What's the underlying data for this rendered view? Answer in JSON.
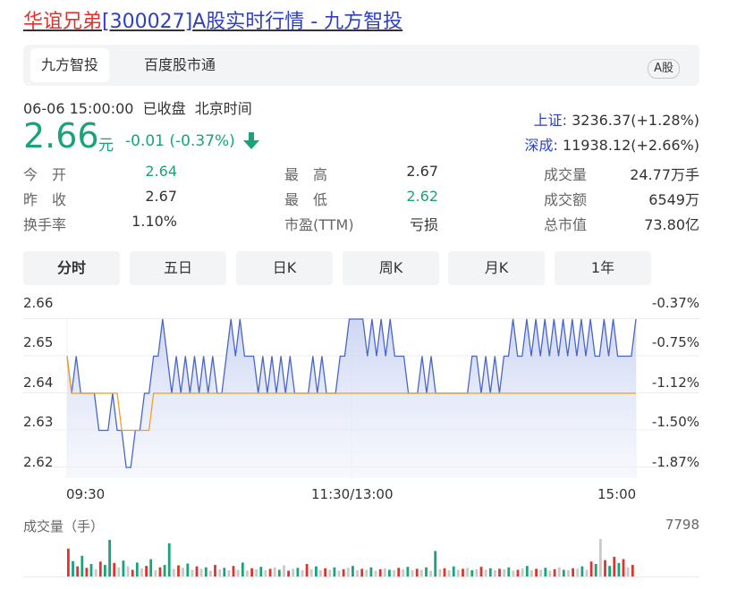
{
  "header": {
    "name": "华谊兄弟",
    "code": "[300027]",
    "suffix": "A股实时行情 - 九方智投"
  },
  "tabs": [
    {
      "label": "九方智投",
      "active": true
    },
    {
      "label": "百度股市通",
      "active": false
    }
  ],
  "badge": "A股",
  "status": {
    "datetime": "06-06 15:00:00",
    "state": "已收盘",
    "tz": "北京时间"
  },
  "price": {
    "value": "2.66",
    "unit": "元",
    "change": "-0.01 (-0.37%)"
  },
  "indices": [
    {
      "name": "上证:",
      "value": "3236.37(+1.28%)"
    },
    {
      "name": "深成:",
      "value": "11938.12(+2.66%)"
    }
  ],
  "quote": [
    [
      {
        "label": "今　开",
        "value": "2.64",
        "green": true
      },
      {
        "label": "最　高",
        "value": "2.67",
        "green": false
      },
      {
        "label": "成交量",
        "value": "24.77万手",
        "green": false
      }
    ],
    [
      {
        "label": "昨　收",
        "value": "2.67",
        "green": false
      },
      {
        "label": "最　低",
        "value": "2.62",
        "green": true
      },
      {
        "label": "成交额",
        "value": "6549万",
        "green": false
      }
    ],
    [
      {
        "label": "换手率",
        "value": "1.10%",
        "green": false
      },
      {
        "label": "市盈(TTM)",
        "value": "亏损",
        "green": false
      },
      {
        "label": "总市值",
        "value": "73.80亿",
        "green": false
      }
    ]
  ],
  "period_tabs": [
    {
      "label": "分时",
      "active": true
    },
    {
      "label": "五日",
      "active": false
    },
    {
      "label": "日K",
      "active": false
    },
    {
      "label": "周K",
      "active": false
    },
    {
      "label": "月K",
      "active": false
    },
    {
      "label": "1年",
      "active": false
    }
  ],
  "colors": {
    "up": "#e0332e",
    "down": "#1aa37a",
    "price_line": "#4a66c8",
    "avg_line": "#f0a21f",
    "link": "#2e3fc4"
  },
  "chart_data": {
    "type": "line",
    "y_ticks": [
      "2.66",
      "2.65",
      "2.64",
      "2.63",
      "2.62"
    ],
    "y_pct_ticks": [
      "-0.37%",
      "-0.75%",
      "-1.12%",
      "-1.50%",
      "-1.87%"
    ],
    "ylim": [
      2.615,
      2.665
    ],
    "x_ticks": [
      "09:30",
      "11:30/13:00",
      "15:00"
    ],
    "series": [
      {
        "name": "",
        "values": [
          2.65,
          2.64,
          2.65,
          2.64,
          2.64,
          2.64,
          2.64,
          2.63,
          2.63,
          2.63,
          2.64,
          2.63,
          2.63,
          2.62,
          2.62,
          2.63,
          2.63,
          2.64,
          2.64,
          2.65,
          2.65,
          2.66,
          2.65,
          2.64,
          2.65,
          2.64,
          2.65,
          2.64,
          2.65,
          2.64,
          2.65,
          2.64,
          2.65,
          2.64,
          2.64,
          2.65,
          2.66,
          2.65,
          2.66,
          2.65,
          2.65,
          2.65,
          2.64,
          2.65,
          2.64,
          2.65,
          2.64,
          2.65,
          2.64,
          2.65,
          2.64,
          2.64,
          2.64,
          2.64,
          2.65,
          2.64,
          2.65,
          2.64,
          2.64,
          2.64,
          2.65,
          2.65,
          2.66,
          2.66,
          2.66,
          2.66,
          2.65,
          2.66,
          2.65,
          2.66,
          2.65,
          2.66,
          2.65,
          2.65,
          2.65,
          2.64,
          2.64,
          2.64,
          2.65,
          2.64,
          2.65,
          2.64,
          2.64,
          2.64,
          2.64,
          2.64,
          2.64,
          2.64,
          2.64,
          2.65,
          2.65,
          2.64,
          2.65,
          2.64,
          2.65,
          2.64,
          2.65,
          2.65,
          2.66,
          2.65,
          2.65,
          2.66,
          2.65,
          2.66,
          2.65,
          2.66,
          2.65,
          2.66,
          2.65,
          2.66,
          2.65,
          2.66,
          2.65,
          2.66,
          2.65,
          2.66,
          2.65,
          2.65,
          2.66,
          2.65,
          2.66,
          2.65,
          2.65,
          2.65,
          2.65,
          2.66
        ]
      },
      {
        "name": "",
        "values": [
          2.65,
          2.64,
          2.64,
          2.64,
          2.64,
          2.64,
          2.64,
          2.64,
          2.64,
          2.64,
          2.64,
          2.64,
          2.63,
          2.63,
          2.63,
          2.63,
          2.63,
          2.63,
          2.63,
          2.64,
          2.64,
          2.64,
          2.64,
          2.64,
          2.64,
          2.64,
          2.64,
          2.64,
          2.64,
          2.64,
          2.64,
          2.64,
          2.64,
          2.64,
          2.64,
          2.64,
          2.64,
          2.64,
          2.64,
          2.64,
          2.64,
          2.64,
          2.64,
          2.64,
          2.64,
          2.64,
          2.64,
          2.64,
          2.64,
          2.64,
          2.64,
          2.64,
          2.64,
          2.64,
          2.64,
          2.64,
          2.64,
          2.64,
          2.64,
          2.64,
          2.64,
          2.64,
          2.64,
          2.64,
          2.64,
          2.64,
          2.64,
          2.64,
          2.64,
          2.64,
          2.64,
          2.64,
          2.64,
          2.64,
          2.64,
          2.64,
          2.64,
          2.64,
          2.64,
          2.64,
          2.64,
          2.64,
          2.64,
          2.64,
          2.64,
          2.64,
          2.64,
          2.64,
          2.64,
          2.64,
          2.64,
          2.64,
          2.64,
          2.64,
          2.64,
          2.64,
          2.64,
          2.64,
          2.64,
          2.64,
          2.64,
          2.64,
          2.64,
          2.64,
          2.64,
          2.64,
          2.64,
          2.64,
          2.64,
          2.64,
          2.64,
          2.64,
          2.64,
          2.64,
          2.64,
          2.64,
          2.64,
          2.64,
          2.64,
          2.64,
          2.64,
          2.64,
          2.64,
          2.64,
          2.64,
          2.64
        ]
      }
    ],
    "volume": {
      "label": "成交量（手）",
      "max_label": "7798",
      "ymax": 7798,
      "bars": [
        [
          5800,
          "up"
        ],
        [
          3200,
          "down"
        ],
        [
          2100,
          "up"
        ],
        [
          4300,
          "down"
        ],
        [
          1800,
          "up"
        ],
        [
          2600,
          "down"
        ],
        [
          1500,
          "gray"
        ],
        [
          3100,
          "up"
        ],
        [
          2400,
          "down"
        ],
        [
          7600,
          "down"
        ],
        [
          2800,
          "up"
        ],
        [
          1900,
          "gray"
        ],
        [
          3300,
          "down"
        ],
        [
          2100,
          "gray"
        ],
        [
          1400,
          "up"
        ],
        [
          2900,
          "down"
        ],
        [
          1700,
          "gray"
        ],
        [
          2200,
          "up"
        ],
        [
          3600,
          "down"
        ],
        [
          1300,
          "gray"
        ],
        [
          1900,
          "up"
        ],
        [
          2400,
          "down"
        ],
        [
          6900,
          "down"
        ],
        [
          1600,
          "gray"
        ],
        [
          2300,
          "up"
        ],
        [
          1800,
          "gray"
        ],
        [
          2700,
          "down"
        ],
        [
          1400,
          "gray"
        ],
        [
          2100,
          "up"
        ],
        [
          1600,
          "gray"
        ],
        [
          1900,
          "down"
        ],
        [
          1200,
          "gray"
        ],
        [
          2400,
          "up"
        ],
        [
          1500,
          "gray"
        ],
        [
          1800,
          "down"
        ],
        [
          1300,
          "gray"
        ],
        [
          2200,
          "up"
        ],
        [
          1400,
          "gray"
        ],
        [
          2900,
          "down"
        ],
        [
          1200,
          "gray"
        ],
        [
          1700,
          "up"
        ],
        [
          1500,
          "gray"
        ],
        [
          2000,
          "down"
        ],
        [
          1300,
          "gray"
        ],
        [
          1600,
          "up"
        ],
        [
          1900,
          "gray"
        ],
        [
          1400,
          "down"
        ],
        [
          2300,
          "gray"
        ],
        [
          1200,
          "up"
        ],
        [
          1600,
          "gray"
        ],
        [
          1800,
          "down"
        ],
        [
          1300,
          "gray"
        ],
        [
          2600,
          "up"
        ],
        [
          1500,
          "gray"
        ],
        [
          2100,
          "down"
        ],
        [
          1300,
          "gray"
        ],
        [
          1700,
          "up"
        ],
        [
          1400,
          "gray"
        ],
        [
          1900,
          "down"
        ],
        [
          1200,
          "gray"
        ],
        [
          1500,
          "up"
        ],
        [
          1800,
          "gray"
        ],
        [
          2200,
          "down"
        ],
        [
          1300,
          "gray"
        ],
        [
          1600,
          "up"
        ],
        [
          1400,
          "gray"
        ],
        [
          1900,
          "down"
        ],
        [
          1200,
          "gray"
        ],
        [
          1500,
          "up"
        ],
        [
          1700,
          "gray"
        ],
        [
          1400,
          "down"
        ],
        [
          1300,
          "gray"
        ],
        [
          1800,
          "up"
        ],
        [
          1500,
          "gray"
        ],
        [
          2000,
          "down"
        ],
        [
          1300,
          "gray"
        ],
        [
          1600,
          "up"
        ],
        [
          1400,
          "gray"
        ],
        [
          1900,
          "down"
        ],
        [
          1200,
          "gray"
        ],
        [
          5300,
          "down"
        ],
        [
          1500,
          "gray"
        ],
        [
          1700,
          "up"
        ],
        [
          1300,
          "gray"
        ],
        [
          2100,
          "down"
        ],
        [
          1400,
          "gray"
        ],
        [
          1600,
          "up"
        ],
        [
          1800,
          "gray"
        ],
        [
          1300,
          "down"
        ],
        [
          1500,
          "gray"
        ],
        [
          2000,
          "up"
        ],
        [
          1400,
          "gray"
        ],
        [
          1700,
          "down"
        ],
        [
          1300,
          "gray"
        ],
        [
          1600,
          "up"
        ],
        [
          1500,
          "gray"
        ],
        [
          1900,
          "down"
        ],
        [
          1200,
          "gray"
        ],
        [
          1400,
          "up"
        ],
        [
          1700,
          "gray"
        ],
        [
          2200,
          "down"
        ],
        [
          1300,
          "gray"
        ],
        [
          1600,
          "up"
        ],
        [
          1400,
          "gray"
        ],
        [
          1800,
          "down"
        ],
        [
          1200,
          "gray"
        ],
        [
          1500,
          "up"
        ],
        [
          1900,
          "gray"
        ],
        [
          1400,
          "down"
        ],
        [
          1300,
          "gray"
        ],
        [
          1700,
          "up"
        ],
        [
          1600,
          "gray"
        ],
        [
          2100,
          "down"
        ],
        [
          1400,
          "gray"
        ],
        [
          3100,
          "up"
        ],
        [
          2600,
          "down"
        ],
        [
          7800,
          "gray"
        ],
        [
          3400,
          "up"
        ],
        [
          2200,
          "down"
        ],
        [
          4100,
          "up"
        ],
        [
          2800,
          "down"
        ],
        [
          3600,
          "up"
        ],
        [
          1900,
          "gray"
        ],
        [
          2400,
          "up"
        ]
      ]
    }
  }
}
